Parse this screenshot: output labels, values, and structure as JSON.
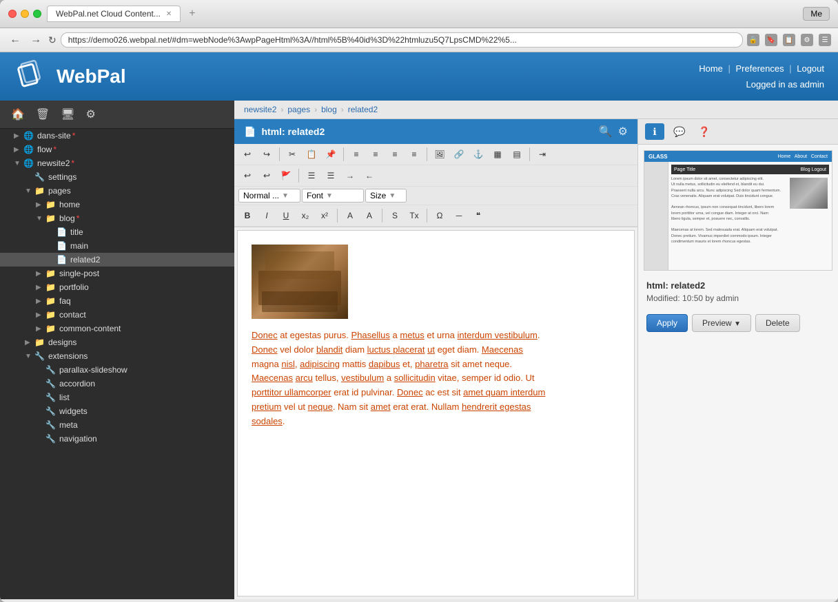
{
  "browser": {
    "url": "https://demo026.webpal.net/#dm=webNode%3AwpPageHtml%3A//html%5B%40id%3D%22htmluzu5Q7LpsCMD%22%5...",
    "tab_title": "WebPal.net Cloud Content...",
    "me_label": "Me"
  },
  "header": {
    "logo_text": "WebPal",
    "nav": {
      "home": "Home",
      "preferences": "Preferences",
      "logout": "Logout",
      "logged_in": "Logged in as admin"
    }
  },
  "sidebar": {
    "toolbar_icons": [
      "home",
      "trash",
      "monitor",
      "settings"
    ],
    "items": [
      {
        "id": "dans-site",
        "label": "dans-site",
        "level": 0,
        "type": "globe",
        "star": "*",
        "star_color": "red",
        "expanded": false
      },
      {
        "id": "flow",
        "label": "flow",
        "level": 0,
        "type": "globe",
        "star": "*",
        "star_color": "red",
        "expanded": false
      },
      {
        "id": "newsite2",
        "label": "newsite2",
        "level": 0,
        "type": "globe",
        "star": "*",
        "star_color": "red",
        "expanded": true
      },
      {
        "id": "settings",
        "label": "settings",
        "level": 1,
        "type": "settings",
        "expanded": false
      },
      {
        "id": "pages",
        "label": "pages",
        "level": 1,
        "type": "folder",
        "expanded": true
      },
      {
        "id": "home",
        "label": "home",
        "level": 2,
        "type": "folder",
        "expanded": false
      },
      {
        "id": "blog",
        "label": "blog",
        "level": 2,
        "type": "folder",
        "star": "*",
        "star_color": "red",
        "expanded": true
      },
      {
        "id": "title",
        "label": "title",
        "level": 3,
        "type": "page",
        "expanded": false
      },
      {
        "id": "main",
        "label": "main",
        "level": 3,
        "type": "page",
        "expanded": false
      },
      {
        "id": "related2",
        "label": "related2",
        "level": 3,
        "type": "page",
        "expanded": false,
        "selected": true
      },
      {
        "id": "single-post",
        "label": "single-post",
        "level": 2,
        "type": "folder",
        "expanded": false
      },
      {
        "id": "portfolio",
        "label": "portfolio",
        "level": 2,
        "type": "folder",
        "expanded": false
      },
      {
        "id": "faq",
        "label": "faq",
        "level": 2,
        "type": "folder",
        "expanded": false
      },
      {
        "id": "contact",
        "label": "contact",
        "level": 2,
        "type": "folder",
        "expanded": false
      },
      {
        "id": "common-content",
        "label": "common-content",
        "level": 2,
        "type": "folder",
        "expanded": false
      },
      {
        "id": "designs",
        "label": "designs",
        "level": 1,
        "type": "folder",
        "expanded": false
      },
      {
        "id": "extensions",
        "label": "extensions",
        "level": 1,
        "type": "wrench",
        "expanded": true
      },
      {
        "id": "parallax-slideshow",
        "label": "parallax-slideshow",
        "level": 2,
        "type": "wrench",
        "expanded": false
      },
      {
        "id": "accordion",
        "label": "accordion",
        "level": 2,
        "type": "wrench",
        "expanded": false
      },
      {
        "id": "list",
        "label": "list",
        "level": 2,
        "type": "wrench",
        "expanded": false
      },
      {
        "id": "widgets",
        "label": "widgets",
        "level": 2,
        "type": "wrench",
        "expanded": false
      },
      {
        "id": "meta",
        "label": "meta",
        "level": 2,
        "type": "wrench",
        "expanded": false
      },
      {
        "id": "navigation",
        "label": "navigation",
        "level": 2,
        "type": "wrench",
        "expanded": false
      }
    ]
  },
  "breadcrumb": {
    "items": [
      "newsite2",
      "pages",
      "blog",
      "related2"
    ]
  },
  "editor": {
    "title": "html: related2",
    "toolbar": {
      "normal_label": "Normal ...",
      "font_label": "Font",
      "size_label": "Size"
    },
    "content": {
      "body_text": "Donec at egestas purus. Phasellus a metus et urna interdum vestibulum. Donec vel dolor blandit diam luctus placerat ut eget diam. Maecenas magna nisl, adipiscing mattis dapibus et, pharetra sit amet neque. Maecenas arcu tellus, vestibulum a sollicitudin vitae, semper id odio. Ut porttitor ullamcorper erat id pulvinar. Donec ac est sit amet quam interdum pretium vel ut neque. Nam sit amet erat erat. Nullam hendrerit egestas sodales."
    }
  },
  "side_panel": {
    "tabs": [
      {
        "id": "info",
        "icon": "ℹ",
        "active": true
      },
      {
        "id": "comment",
        "icon": "💬",
        "active": false
      },
      {
        "id": "help",
        "icon": "❓",
        "active": false
      }
    ],
    "preview_title": "Page Title",
    "preview_subtitle": "Blog Logout",
    "info_title": "html: related2",
    "info_meta": "Modified: 10:50 by admin",
    "buttons": {
      "apply": "Apply",
      "preview": "Preview",
      "delete": "Delete"
    }
  }
}
